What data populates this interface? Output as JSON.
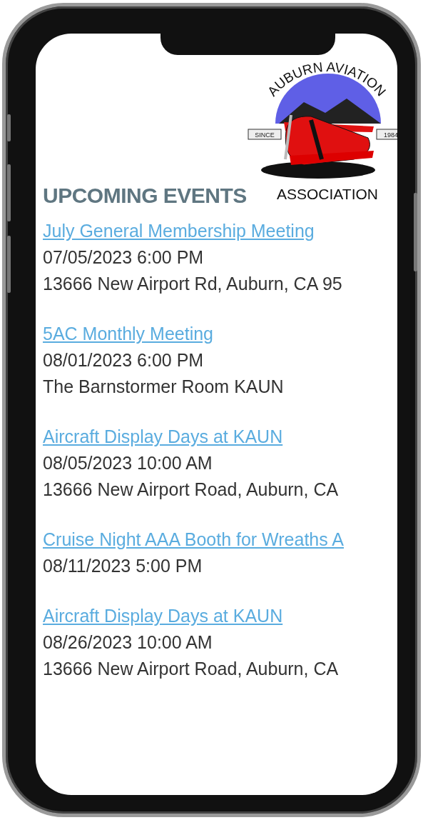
{
  "logo": {
    "arc_text": "AUBURN AVIATION",
    "since": "SINCE",
    "year": "1984",
    "bottom_text": "ASSOCIATION"
  },
  "heading": "UPCOMING EVENTS",
  "events": [
    {
      "title": "July General Membership Meeting",
      "when": "07/05/2023 6:00 PM",
      "where": "13666 New Airport Rd, Auburn, CA 95"
    },
    {
      "title": "5AC Monthly Meeting",
      "when": "08/01/2023 6:00 PM",
      "where": "The Barnstormer Room KAUN"
    },
    {
      "title": "Aircraft Display Days at KAUN",
      "when": "08/05/2023 10:00 AM",
      "where": "13666 New Airport Road, Auburn, CA"
    },
    {
      "title": "Cruise Night AAA Booth for Wreaths A",
      "when": "08/11/2023 5:00 PM"
    },
    {
      "title": "Aircraft Display Days at KAUN",
      "when": "08/26/2023 10:00 AM",
      "where": "13666 New Airport Road, Auburn, CA"
    }
  ]
}
